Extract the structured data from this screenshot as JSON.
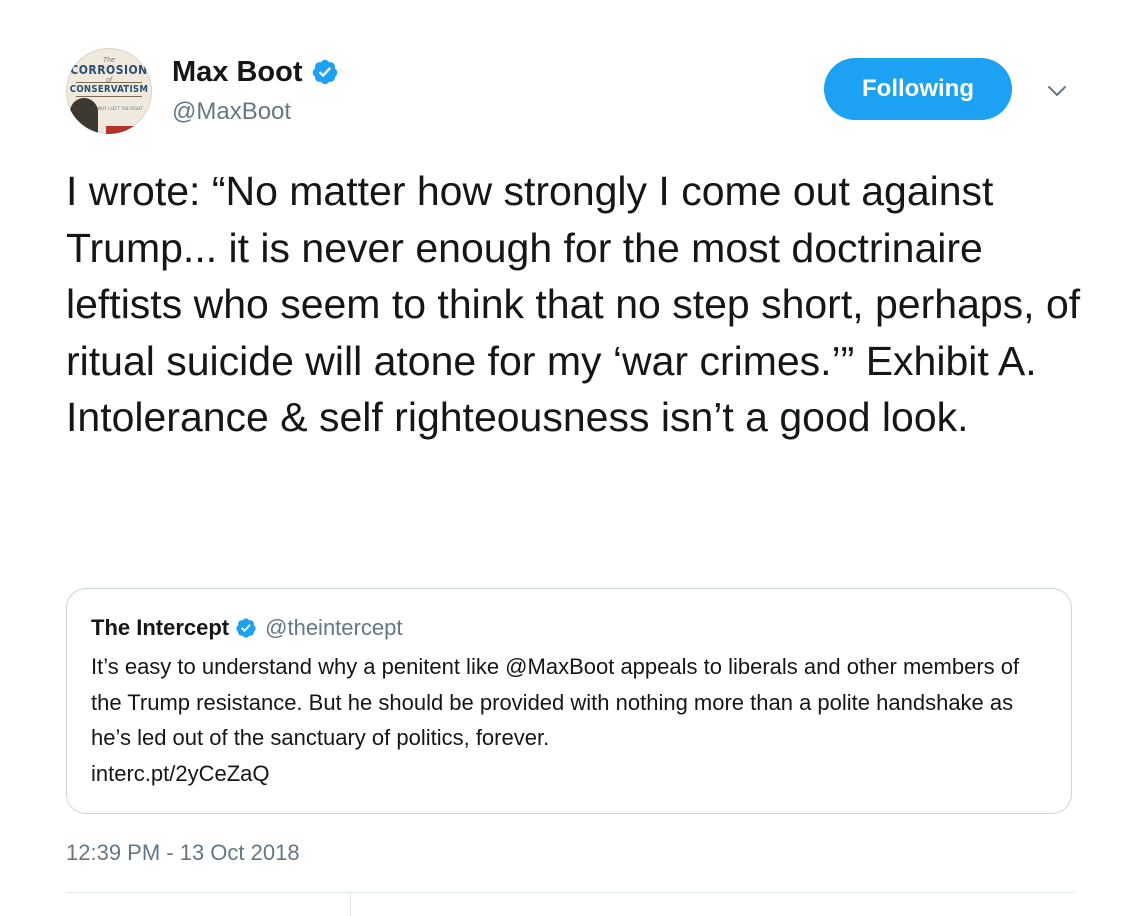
{
  "user": {
    "name": "Max Boot",
    "handle": "@MaxBoot",
    "verified": true,
    "avatar": {
      "line1": "The",
      "line2": "CORROSION",
      "line3": "of",
      "line4": "CONSERVATISM",
      "line5": "WHY I LEFT THE RIGHT"
    }
  },
  "follow_button": {
    "label": "Following"
  },
  "tweet": {
    "text": "I wrote: “No matter how strongly I come out against Trump... it is never enough for the most doctrinaire leftists who seem to think that no step short, perhaps, of ritual suicide will atone for my ‘war crimes.’” Exhibit A. Intolerance & self righteousness isn’t a good look.",
    "timestamp": "12:39 PM - 13 Oct 2018"
  },
  "quoted_tweet": {
    "name": "The Intercept",
    "handle": "@theintercept",
    "verified": true,
    "text": "It’s easy to understand why a penitent like @MaxBoot appeals to liberals and other members of the Trump resistance. But he should be provided with nothing more than a polite handshake as he’s led out of the sanctuary of politics, forever.",
    "link": "interc.pt/2yCeZaQ"
  },
  "colors": {
    "accent": "#1da1f2",
    "text": "#14171a",
    "secondary_text": "#657786",
    "border": "#ccd6dd"
  },
  "icons": {
    "verified": "verified-badge-icon",
    "menu": "chevron-down-icon"
  }
}
